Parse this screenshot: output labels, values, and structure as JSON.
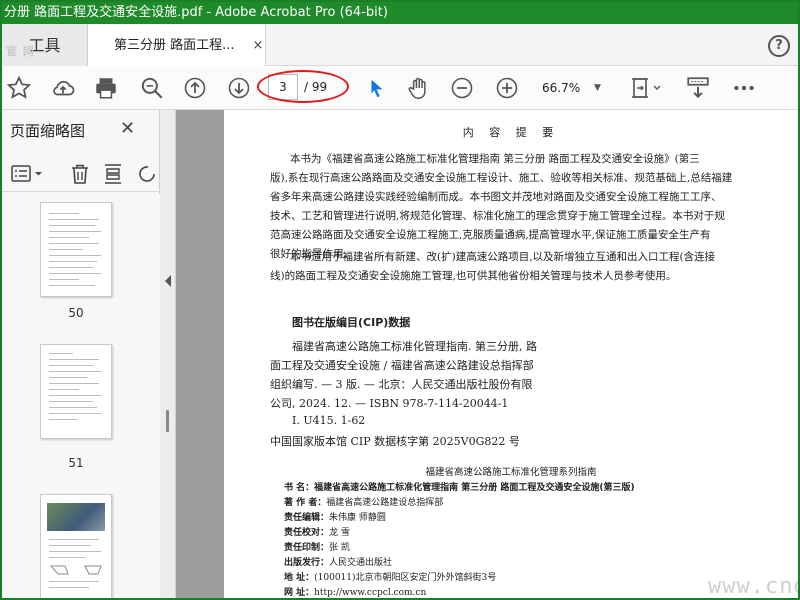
{
  "window": {
    "title": "分册 路面工程及交通安全设施.pdf - Adobe Acrobat Pro (64-bit)"
  },
  "tabs": {
    "tools_label": "工具",
    "watermark": "官 网",
    "doc_label": "第三分册 路面工程...",
    "close": "×",
    "help": "?"
  },
  "toolbar": {
    "page_current": "3",
    "page_total": "/ 99",
    "zoom": "66.7%",
    "accent": "#1473e6",
    "highlight": "#e11b1b"
  },
  "sidebar": {
    "title": "页面缩略图",
    "close": "✕",
    "thumbnails": [
      {
        "label": "50"
      },
      {
        "label": "51"
      }
    ]
  },
  "document": {
    "heading": "内 容 提 要",
    "para1_lines": [
      "本书为《福建省高速公路施工标准化管理指南  第三分册  路面工程及交通安全设施》(第三",
      "版),系在现行高速公路路面及交通安全设施工程设计、施工、验收等相关标准、规范基础上,总结福建",
      "省多年来高速公路建设实践经验编制而成。本书图文并茂地对路面及交通安全设施工程施工工序、",
      "技术、工艺和管理进行说明,将规范化管理、标准化施工的理念贯穿于施工管理全过程。本书对于规",
      "范高速公路路面及交通安全设施工程施工,克服质量通病,提高管理水平,保证施工质量安全生产有",
      "很好的指导作用。"
    ],
    "para2_lines": [
      "本书适用于福建省所有新建、改(扩)建高速公路项目,以及新增独立互通和出入口工程(含连接",
      "线)的路面工程及交通安全设施施工管理,也可供其他省份相关管理与技术人员参考使用。"
    ],
    "cip_title": "图书在版编目(CIP)数据",
    "cip_lines": [
      "福建省高速公路施工标准化管理指南. 第三分册, 路",
      "面工程及交通安全设施 / 福建省高速公路建设总指挥部",
      "组织编写. — 3 版. — 北京：人民交通出版社股份有限",
      "公司, 2024. 12. — ISBN 978-7-114-20044-1",
      "Ⅰ. U415. 1-62",
      "中国国家版本馆 CIP 数据核字第 2025V0G822 号"
    ],
    "series": "福建省高速公路施工标准化管理系列指南",
    "meta": [
      {
        "k": "书    名：",
        "v": "福建省高速公路施工标准化管理指南  第三分册  路面工程及交通安全设施(第三版)"
      },
      {
        "k": "著 作 者：",
        "v": "福建省高速公路建设总指挥部"
      },
      {
        "k": "责任编辑：",
        "v": "朱伟康  师静圆"
      },
      {
        "k": "责任校对：",
        "v": "龙  雪"
      },
      {
        "k": "责任印制：",
        "v": "张  凯"
      },
      {
        "k": "出版发行：",
        "v": "人民交通出版社"
      },
      {
        "k": "地    址：",
        "v": "(100011)北京市朝阳区安定门外外馆斜街3号"
      },
      {
        "k": "网    址：",
        "v": "http://www.ccpcl.com.cn"
      }
    ],
    "watermark": "www.cndao.com"
  }
}
